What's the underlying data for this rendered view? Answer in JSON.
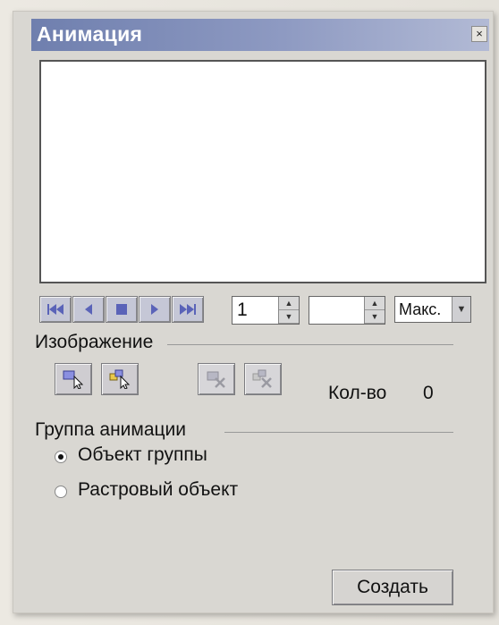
{
  "window": {
    "title": "Анимация",
    "close_glyph": "×"
  },
  "playback": {
    "first_icon": "skip-first-icon",
    "prev_icon": "step-back-icon",
    "stop_icon": "stop-icon",
    "next_icon": "step-forward-icon",
    "last_icon": "skip-last-icon"
  },
  "frame_spinner": {
    "value": "1"
  },
  "second_spinner": {
    "value": ""
  },
  "speed_combo": {
    "value": "Макс."
  },
  "image_section": {
    "label": "Изображение",
    "count_label": "Кол-во",
    "count_value": "0"
  },
  "group_section": {
    "label": "Группа анимации",
    "options": [
      {
        "label": "Объект группы",
        "selected": true
      },
      {
        "label": "Растровый объект",
        "selected": false
      }
    ]
  },
  "create_button": {
    "label": "Создать"
  },
  "colors": {
    "title_bar_start": "#6f7fae",
    "title_bar_end": "#b2bad5",
    "icon_accent": "#5a63b8"
  }
}
